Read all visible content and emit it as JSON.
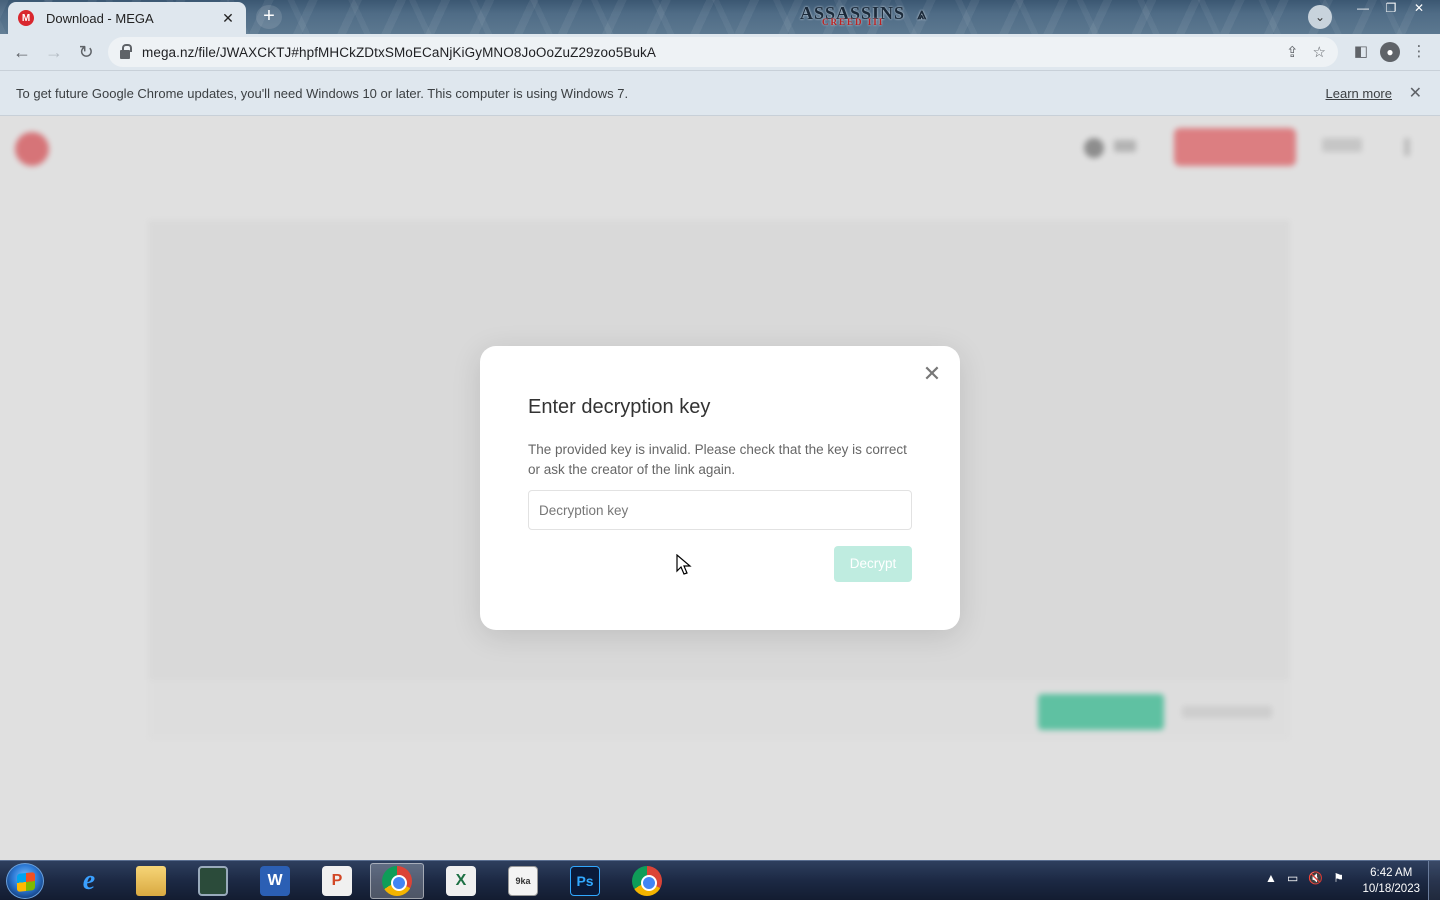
{
  "browser": {
    "tab_title": "Download - MEGA",
    "tab_favicon": "M",
    "tab_close": "✕",
    "new_tab": "+",
    "url": "mega.nz/file/JWAXCKTJ#hpfMHCkZDtxSMoECaNjKiGyMNO8JoOoZuZ29zoo5BukA",
    "theme_logo_text": "ASSASSINS",
    "theme_logo_sub": "CREED III",
    "window_controls": {
      "minimize": "—",
      "restore": "❐",
      "close": "✕"
    }
  },
  "infobar": {
    "message": "To get future Google Chrome updates, you'll need Windows 10 or later. This computer is using Windows 7.",
    "learn_more": "Learn more",
    "close": "✕"
  },
  "dialog": {
    "title": "Enter decryption key",
    "description": "The provided key is invalid. Please check that the key is correct or ask the creator of the link again.",
    "input_placeholder": "Decryption key",
    "input_value": "",
    "decrypt_button": "Decrypt",
    "close": "✕"
  },
  "taskbar": {
    "apps": [
      {
        "name": "internet-explorer",
        "label": "e"
      },
      {
        "name": "file-explorer",
        "label": ""
      },
      {
        "name": "system-monitor",
        "label": ""
      },
      {
        "name": "word",
        "label": "W"
      },
      {
        "name": "powerpoint",
        "label": "P"
      },
      {
        "name": "chrome",
        "label": "",
        "active": true
      },
      {
        "name": "excel",
        "label": "X"
      },
      {
        "name": "spreadsheet-doc",
        "label": "9ka"
      },
      {
        "name": "photoshop",
        "label": "Ps"
      },
      {
        "name": "chrome-2",
        "label": ""
      }
    ],
    "time": "6:42 AM",
    "date": "10/18/2023",
    "tray_expand": "▲"
  },
  "colors": {
    "mega_red": "#d9272e",
    "mega_green": "#00b37a",
    "decrypt_disabled": "#bfece0"
  }
}
